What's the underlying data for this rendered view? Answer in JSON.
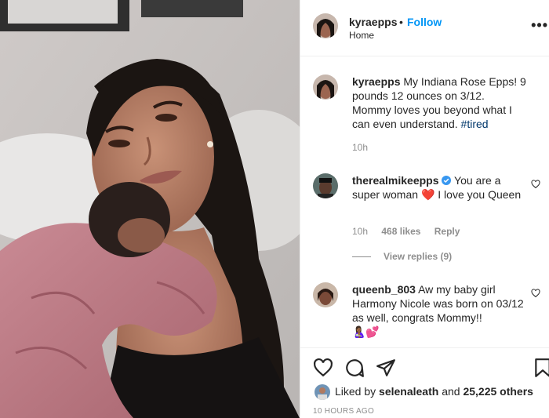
{
  "post": {
    "username": "kyraepps",
    "follow_label": "Follow",
    "location": "Home",
    "more_glyph": "•••"
  },
  "caption": {
    "username": "kyraepps",
    "text": "My Indiana Rose Epps! 9 pounds 12 ounces on 3/12. Mommy loves you beyond what I can even understand.",
    "hashtag": "#tired",
    "time": "10h"
  },
  "comments": [
    {
      "username": "therealmikeepps",
      "verified": true,
      "text_before": "You are a super woman",
      "emoji": "❤️",
      "text_after": "I love you Queen",
      "time": "10h",
      "likes": "468 likes",
      "reply_label": "Reply",
      "view_replies": "View replies (9)"
    },
    {
      "username": "queenb_803",
      "text": "Aw my baby girl Harmony Nicole was born on 03/12 as well, congrats Mommy!!",
      "emojis": "🤱🏾💕"
    }
  ],
  "actions": {
    "icons": [
      "heart-icon",
      "comment-icon",
      "share-icon",
      "save-icon"
    ]
  },
  "likes": {
    "liked_by_prefix": "Liked by",
    "liked_by_user": "selenaleath",
    "and_text": "and",
    "others": "25,225 others"
  },
  "timestamp": "10 HOURS AGO",
  "colors": {
    "accent": "#0095f6",
    "hashtag": "#00376b",
    "muted": "#8e8e8e",
    "heart": "#e0245e"
  }
}
